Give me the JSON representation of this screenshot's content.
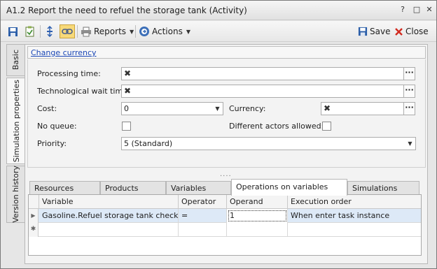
{
  "window": {
    "title": "A1.2 Report the need to refuel the storage tank (Activity)",
    "controls": [
      "?",
      "□",
      "✕"
    ]
  },
  "toolbar": {
    "reports_label": "Reports",
    "actions_label": "Actions",
    "save_label": "Save",
    "close_label": "Close"
  },
  "side_tabs": [
    {
      "label": "Basic"
    },
    {
      "label": "Simulation properties"
    },
    {
      "label": "Version history"
    }
  ],
  "currency_link": "Change currency",
  "form": {
    "processing_time_label": "Processing time:",
    "processing_time_value": "",
    "tech_wait_label": "Technological wait time:",
    "tech_wait_value": "",
    "cost_label": "Cost:",
    "cost_value": "0",
    "currency_label": "Currency:",
    "currency_value": "",
    "no_queue_label": "No queue:",
    "no_queue_checked": false,
    "diff_actors_label": "Different actors allowed:",
    "diff_actors_checked": false,
    "priority_label": "Priority:",
    "priority_value": "5 (Standard)"
  },
  "splitter": "....",
  "tabs": [
    {
      "label": "Resources"
    },
    {
      "label": "Products"
    },
    {
      "label": "Variables"
    },
    {
      "label": "Operations on variables"
    },
    {
      "label": "Simulations"
    }
  ],
  "active_tab": "Operations on variables",
  "grid": {
    "columns": [
      "Variable",
      "Operator",
      "Operand",
      "Execution order"
    ],
    "rows": [
      {
        "variable": "Gasoline.Refuel storage tank checkbox",
        "operator": "=",
        "operand": "1",
        "execution_order": "When enter task instance"
      }
    ],
    "new_row_marker": "✱"
  }
}
